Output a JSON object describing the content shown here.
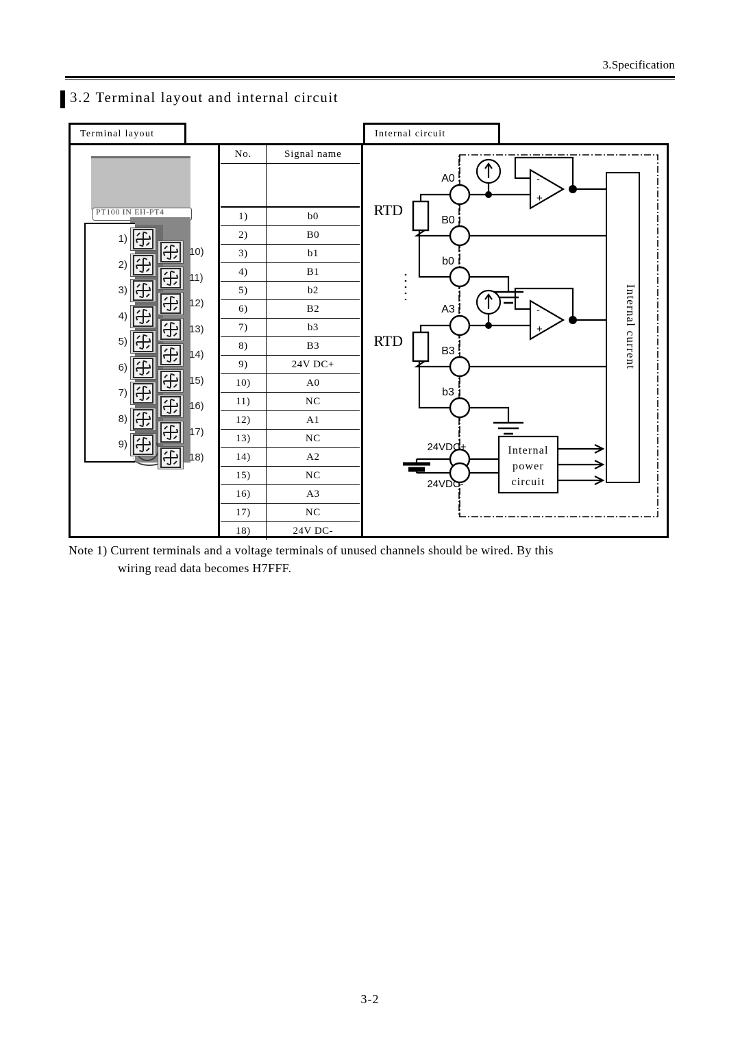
{
  "header": {
    "chapter_title": "3.Specification"
  },
  "section": {
    "number": "3.2",
    "title": "3.2 Terminal layout and internal circuit"
  },
  "tabs": {
    "terminal_layout": "Terminal layout",
    "internal_circuit": "Internal circuit"
  },
  "terminal_art": {
    "nameplate": "PT100 IN EH-PT4",
    "left_numbers": [
      "1)",
      "2)",
      "3)",
      "4)",
      "5)",
      "6)",
      "7)",
      "8)",
      "9)"
    ],
    "right_numbers": [
      "10)",
      "11)",
      "12)",
      "13)",
      "14)",
      "15)",
      "16)",
      "17)",
      "18)"
    ]
  },
  "signal_table": {
    "headers": {
      "no": "No.",
      "signal_name": "Signal name"
    },
    "rows": [
      {
        "no": "1)",
        "signal": "b0"
      },
      {
        "no": "2)",
        "signal": "B0"
      },
      {
        "no": "3)",
        "signal": "b1"
      },
      {
        "no": "4)",
        "signal": "B1"
      },
      {
        "no": "5)",
        "signal": "b2"
      },
      {
        "no": "6)",
        "signal": "B2"
      },
      {
        "no": "7)",
        "signal": "b3"
      },
      {
        "no": "8)",
        "signal": "B3"
      },
      {
        "no": "9)",
        "signal": "24V DC+"
      },
      {
        "no": "10)",
        "signal": "A0"
      },
      {
        "no": "11)",
        "signal": "NC"
      },
      {
        "no": "12)",
        "signal": "A1"
      },
      {
        "no": "13)",
        "signal": "NC"
      },
      {
        "no": "14)",
        "signal": "A2"
      },
      {
        "no": "15)",
        "signal": "NC"
      },
      {
        "no": "16)",
        "signal": "A3"
      },
      {
        "no": "17)",
        "signal": "NC"
      },
      {
        "no": "18)",
        "signal": "24V DC-"
      }
    ]
  },
  "circuit": {
    "channel_0": {
      "sensor_label": "RTD",
      "terminal_a": "A0",
      "terminal_b": "B0",
      "terminal_b_low": "b0",
      "opamp_minus": "-",
      "opamp_plus": "+"
    },
    "channel_3": {
      "sensor_label": "RTD",
      "terminal_a": "A3",
      "terminal_b": "B3",
      "terminal_b_low": "b3",
      "opamp_minus": "-",
      "opamp_plus": "+"
    },
    "internal_block_label": "Internal current",
    "power": {
      "positive_terminal": "24VDC+",
      "negative_terminal": "24VDC-",
      "box_line_1": "Internal",
      "box_line_2": "power",
      "box_line_3": "circuit"
    }
  },
  "note": {
    "line_1": "Note 1) Current terminals and a voltage terminals of unused channels should be wired. By this",
    "line_2": "wiring read data becomes H7FFF."
  },
  "footer": {
    "page_number": "3-2"
  }
}
